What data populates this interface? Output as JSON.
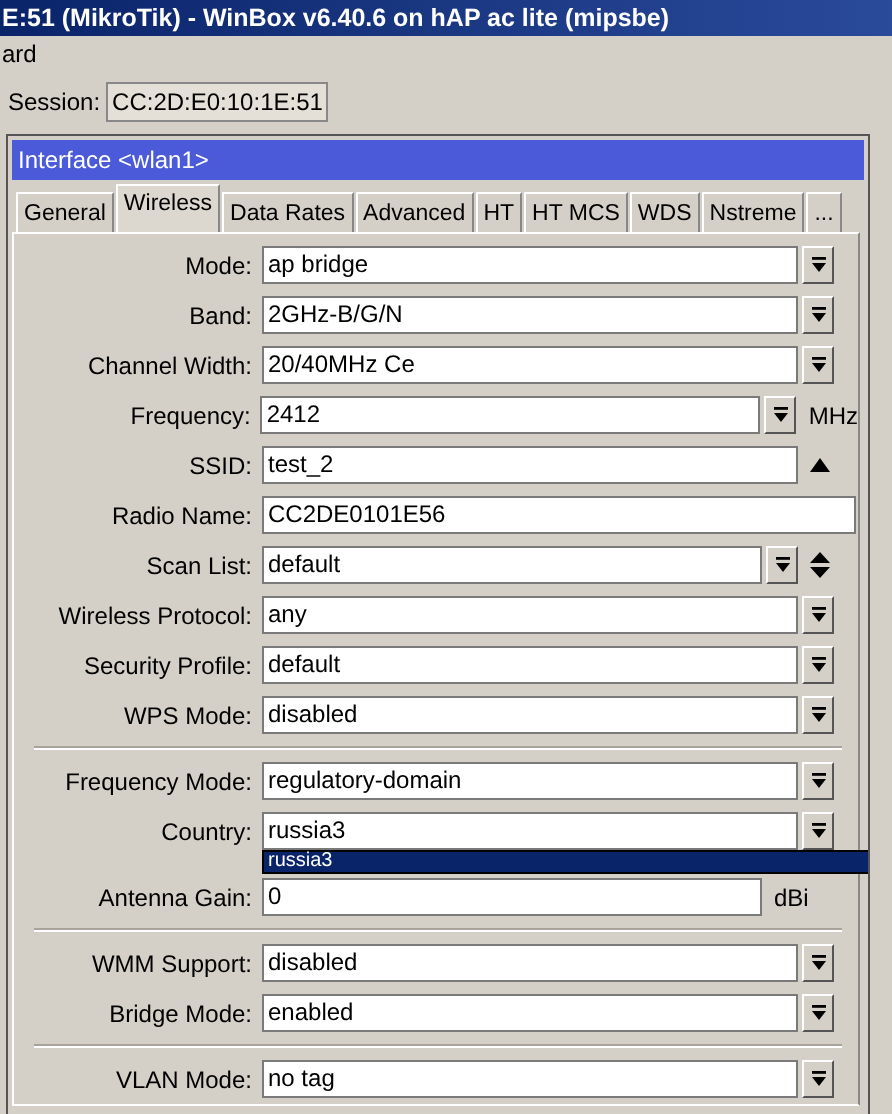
{
  "window": {
    "title": "E:51 (MikroTik) - WinBox v6.40.6 on hAP ac lite (mipsbe)"
  },
  "menu": [
    "ard"
  ],
  "session": {
    "label": "Session:",
    "value": "CC:2D:E0:10:1E:51"
  },
  "dialog": {
    "title": "Interface <wlan1>",
    "tabs": [
      {
        "label": "General",
        "selected": false
      },
      {
        "label": "Wireless",
        "selected": true
      },
      {
        "label": "Data Rates",
        "selected": false
      },
      {
        "label": "Advanced",
        "selected": false
      },
      {
        "label": "HT",
        "selected": false
      },
      {
        "label": "HT MCS",
        "selected": false
      },
      {
        "label": "WDS",
        "selected": false
      },
      {
        "label": "Nstreme",
        "selected": false
      },
      {
        "label": "...",
        "selected": false
      }
    ],
    "sections": [
      {
        "fields": [
          {
            "label": "Mode:",
            "value": "ap bridge",
            "kind": "select"
          },
          {
            "label": "Band:",
            "value": "2GHz-B/G/N",
            "kind": "select"
          },
          {
            "label": "Channel Width:",
            "value": "20/40MHz Ce",
            "kind": "select"
          },
          {
            "label": "Frequency:",
            "value": "2412",
            "kind": "select",
            "unit": "MHz"
          },
          {
            "label": "SSID:",
            "value": "test_2",
            "kind": "collapse"
          },
          {
            "label": "Radio Name:",
            "value": "CC2DE0101E56",
            "kind": "text"
          },
          {
            "label": "Scan List:",
            "value": "default",
            "kind": "multi"
          },
          {
            "label": "Wireless Protocol:",
            "value": "any",
            "kind": "select"
          },
          {
            "label": "Security Profile:",
            "value": "default",
            "kind": "select"
          },
          {
            "label": "WPS Mode:",
            "value": "disabled",
            "kind": "select"
          }
        ]
      },
      {
        "fields": [
          {
            "label": "Frequency Mode:",
            "value": "regulatory-domain",
            "kind": "select"
          },
          {
            "label": "Country:",
            "value": "russia3",
            "kind": "select",
            "options": [
              {
                "label": "russia3",
                "selected": true
              }
            ]
          },
          {
            "label": "Antenna Gain:",
            "value": "0",
            "kind": "text",
            "unit": "dBi"
          }
        ]
      },
      {
        "fields": [
          {
            "label": "WMM Support:",
            "value": "disabled",
            "kind": "select"
          },
          {
            "label": "Bridge Mode:",
            "value": "enabled",
            "kind": "select"
          }
        ]
      },
      {
        "fields": [
          {
            "label": "VLAN Mode:",
            "value": "no tag",
            "kind": "select"
          }
        ]
      }
    ]
  }
}
